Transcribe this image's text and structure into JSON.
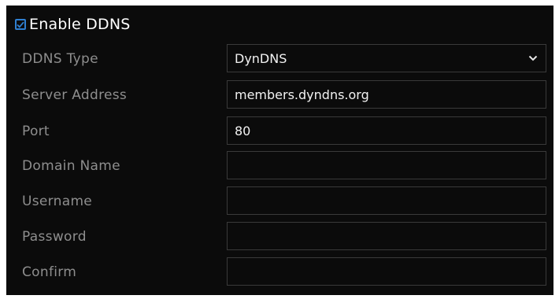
{
  "enable_ddns": {
    "label": "Enable DDNS",
    "checked": true
  },
  "fields": [
    {
      "label": "DDNS Type",
      "kind": "select",
      "value": "DynDNS"
    },
    {
      "label": "Server Address",
      "kind": "text",
      "value": "members.dyndns.org"
    },
    {
      "label": "Port",
      "kind": "text",
      "value": "80"
    },
    {
      "label": "Domain Name",
      "kind": "text",
      "value": ""
    },
    {
      "label": "Username",
      "kind": "text",
      "value": ""
    },
    {
      "label": "Password",
      "kind": "password",
      "value": ""
    },
    {
      "label": "Confirm",
      "kind": "password",
      "value": ""
    }
  ],
  "colors": {
    "background": "#0b0b0b",
    "label": "#8e8e8e",
    "value": "#f2f2f2",
    "field_border": "#3a3a3a",
    "checkbox": "#2f7fd0"
  },
  "icons": {
    "checkbox": "checkmark-icon",
    "dropdown": "chevron-down-icon"
  }
}
